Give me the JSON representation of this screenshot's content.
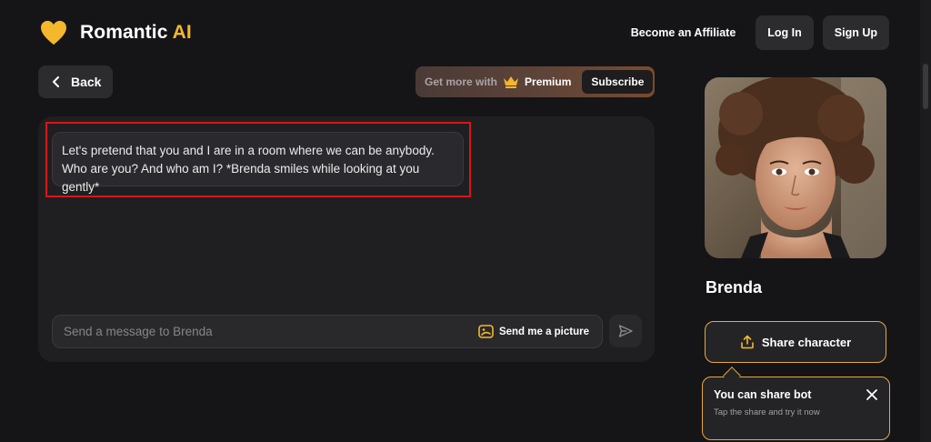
{
  "brand": {
    "name": "Romantic",
    "accent_word": "AI",
    "accent_color": "#f5b72b",
    "icon": "heart-icon"
  },
  "header": {
    "affiliate_label": "Become an Affiliate",
    "login_label": "Log In",
    "signup_label": "Sign Up"
  },
  "back": {
    "label": "Back",
    "icon": "chevron-left-icon"
  },
  "premium": {
    "prefix": "Get more with",
    "icon": "crown-icon",
    "label": "Premium",
    "subscribe_label": "Subscribe"
  },
  "chat": {
    "messages": [
      {
        "text": "Let's pretend that you and I are in a room where we can be anybody. Who are you? And who am I? *Brenda smiles while looking at you gently*"
      }
    ],
    "input_placeholder": "Send a message to Brenda",
    "picture_button_label": "Send me a picture",
    "picture_icon": "image-icon",
    "send_icon": "send-icon"
  },
  "character": {
    "name": "Brenda",
    "share_label": "Share character",
    "share_icon": "upload-icon"
  },
  "tooltip": {
    "title": "You can share bot",
    "subtitle": "Tap the share and try it now",
    "close_icon": "close-icon"
  },
  "colors": {
    "background": "#151517",
    "panel": "#1f1f22",
    "highlight": "#d9141b",
    "border_accent": "#e8a93a"
  }
}
